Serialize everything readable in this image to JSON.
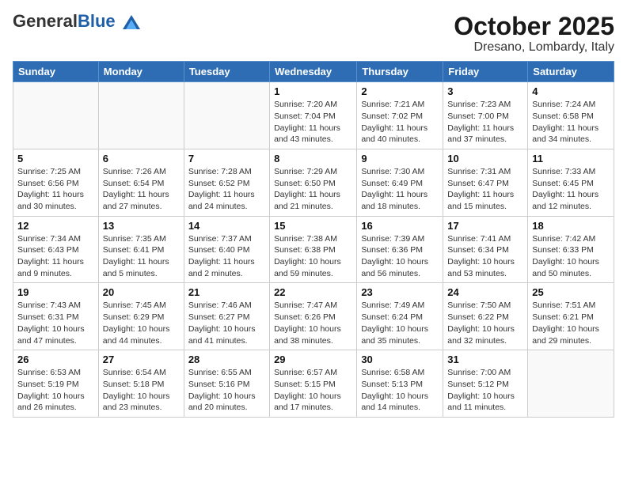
{
  "header": {
    "logo_general": "General",
    "logo_blue": "Blue",
    "title": "October 2025",
    "subtitle": "Dresano, Lombardy, Italy"
  },
  "calendar": {
    "days_of_week": [
      "Sunday",
      "Monday",
      "Tuesday",
      "Wednesday",
      "Thursday",
      "Friday",
      "Saturday"
    ],
    "weeks": [
      [
        {
          "day": "",
          "info": ""
        },
        {
          "day": "",
          "info": ""
        },
        {
          "day": "",
          "info": ""
        },
        {
          "day": "1",
          "info": "Sunrise: 7:20 AM\nSunset: 7:04 PM\nDaylight: 11 hours and 43 minutes."
        },
        {
          "day": "2",
          "info": "Sunrise: 7:21 AM\nSunset: 7:02 PM\nDaylight: 11 hours and 40 minutes."
        },
        {
          "day": "3",
          "info": "Sunrise: 7:23 AM\nSunset: 7:00 PM\nDaylight: 11 hours and 37 minutes."
        },
        {
          "day": "4",
          "info": "Sunrise: 7:24 AM\nSunset: 6:58 PM\nDaylight: 11 hours and 34 minutes."
        }
      ],
      [
        {
          "day": "5",
          "info": "Sunrise: 7:25 AM\nSunset: 6:56 PM\nDaylight: 11 hours and 30 minutes."
        },
        {
          "day": "6",
          "info": "Sunrise: 7:26 AM\nSunset: 6:54 PM\nDaylight: 11 hours and 27 minutes."
        },
        {
          "day": "7",
          "info": "Sunrise: 7:28 AM\nSunset: 6:52 PM\nDaylight: 11 hours and 24 minutes."
        },
        {
          "day": "8",
          "info": "Sunrise: 7:29 AM\nSunset: 6:50 PM\nDaylight: 11 hours and 21 minutes."
        },
        {
          "day": "9",
          "info": "Sunrise: 7:30 AM\nSunset: 6:49 PM\nDaylight: 11 hours and 18 minutes."
        },
        {
          "day": "10",
          "info": "Sunrise: 7:31 AM\nSunset: 6:47 PM\nDaylight: 11 hours and 15 minutes."
        },
        {
          "day": "11",
          "info": "Sunrise: 7:33 AM\nSunset: 6:45 PM\nDaylight: 11 hours and 12 minutes."
        }
      ],
      [
        {
          "day": "12",
          "info": "Sunrise: 7:34 AM\nSunset: 6:43 PM\nDaylight: 11 hours and 9 minutes."
        },
        {
          "day": "13",
          "info": "Sunrise: 7:35 AM\nSunset: 6:41 PM\nDaylight: 11 hours and 5 minutes."
        },
        {
          "day": "14",
          "info": "Sunrise: 7:37 AM\nSunset: 6:40 PM\nDaylight: 11 hours and 2 minutes."
        },
        {
          "day": "15",
          "info": "Sunrise: 7:38 AM\nSunset: 6:38 PM\nDaylight: 10 hours and 59 minutes."
        },
        {
          "day": "16",
          "info": "Sunrise: 7:39 AM\nSunset: 6:36 PM\nDaylight: 10 hours and 56 minutes."
        },
        {
          "day": "17",
          "info": "Sunrise: 7:41 AM\nSunset: 6:34 PM\nDaylight: 10 hours and 53 minutes."
        },
        {
          "day": "18",
          "info": "Sunrise: 7:42 AM\nSunset: 6:33 PM\nDaylight: 10 hours and 50 minutes."
        }
      ],
      [
        {
          "day": "19",
          "info": "Sunrise: 7:43 AM\nSunset: 6:31 PM\nDaylight: 10 hours and 47 minutes."
        },
        {
          "day": "20",
          "info": "Sunrise: 7:45 AM\nSunset: 6:29 PM\nDaylight: 10 hours and 44 minutes."
        },
        {
          "day": "21",
          "info": "Sunrise: 7:46 AM\nSunset: 6:27 PM\nDaylight: 10 hours and 41 minutes."
        },
        {
          "day": "22",
          "info": "Sunrise: 7:47 AM\nSunset: 6:26 PM\nDaylight: 10 hours and 38 minutes."
        },
        {
          "day": "23",
          "info": "Sunrise: 7:49 AM\nSunset: 6:24 PM\nDaylight: 10 hours and 35 minutes."
        },
        {
          "day": "24",
          "info": "Sunrise: 7:50 AM\nSunset: 6:22 PM\nDaylight: 10 hours and 32 minutes."
        },
        {
          "day": "25",
          "info": "Sunrise: 7:51 AM\nSunset: 6:21 PM\nDaylight: 10 hours and 29 minutes."
        }
      ],
      [
        {
          "day": "26",
          "info": "Sunrise: 6:53 AM\nSunset: 5:19 PM\nDaylight: 10 hours and 26 minutes."
        },
        {
          "day": "27",
          "info": "Sunrise: 6:54 AM\nSunset: 5:18 PM\nDaylight: 10 hours and 23 minutes."
        },
        {
          "day": "28",
          "info": "Sunrise: 6:55 AM\nSunset: 5:16 PM\nDaylight: 10 hours and 20 minutes."
        },
        {
          "day": "29",
          "info": "Sunrise: 6:57 AM\nSunset: 5:15 PM\nDaylight: 10 hours and 17 minutes."
        },
        {
          "day": "30",
          "info": "Sunrise: 6:58 AM\nSunset: 5:13 PM\nDaylight: 10 hours and 14 minutes."
        },
        {
          "day": "31",
          "info": "Sunrise: 7:00 AM\nSunset: 5:12 PM\nDaylight: 10 hours and 11 minutes."
        },
        {
          "day": "",
          "info": ""
        }
      ]
    ]
  }
}
